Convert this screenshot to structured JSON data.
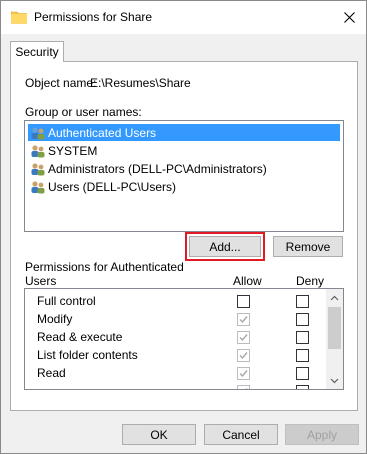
{
  "window": {
    "title": "Permissions for Share",
    "close_glyph": "✕"
  },
  "tabs": [
    {
      "label": "Security"
    }
  ],
  "security": {
    "object_name_label": "Object name:",
    "object_name_value": "E:\\Resumes\\Share",
    "group_label": "Group or user names:",
    "users": [
      {
        "name": "Authenticated Users",
        "selected": true
      },
      {
        "name": "SYSTEM",
        "selected": false
      },
      {
        "name": "Administrators (DELL-PC\\Administrators)",
        "selected": false
      },
      {
        "name": "Users (DELL-PC\\Users)",
        "selected": false
      }
    ],
    "add_button": "Add...",
    "remove_button": "Remove",
    "permissions_label": "Permissions for Authenticated Users",
    "allow_header": "Allow",
    "deny_header": "Deny",
    "permissions": [
      {
        "name": "Full control",
        "allow": false,
        "allow_disabled": false,
        "deny": false
      },
      {
        "name": "Modify",
        "allow": true,
        "allow_disabled": true,
        "deny": false
      },
      {
        "name": "Read & execute",
        "allow": true,
        "allow_disabled": true,
        "deny": false
      },
      {
        "name": "List folder contents",
        "allow": true,
        "allow_disabled": true,
        "deny": false
      },
      {
        "name": "Read",
        "allow": true,
        "allow_disabled": true,
        "deny": false
      },
      {
        "name": "",
        "allow": true,
        "allow_disabled": true,
        "deny": false
      }
    ]
  },
  "footer": {
    "ok": "OK",
    "cancel": "Cancel",
    "apply": "Apply"
  },
  "colors": {
    "selection": "#3399ff",
    "highlight_outline": "#e01b24"
  }
}
